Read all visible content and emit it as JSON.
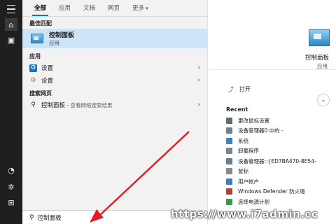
{
  "tabs": [
    {
      "label": "全部",
      "active": true
    },
    {
      "label": "应用"
    },
    {
      "label": "文档"
    },
    {
      "label": "网页"
    },
    {
      "label": "更多",
      "caret": "▾"
    }
  ],
  "best_match": {
    "header": "最佳匹配",
    "title": "控制面板",
    "subtitle": "应用"
  },
  "apps": {
    "header": "应用",
    "items": [
      {
        "label": "设置",
        "icon": "gear-blue-icon"
      },
      {
        "label": "设置",
        "icon": "gear-orange-icon"
      }
    ]
  },
  "web": {
    "header": "搜索网页",
    "items": [
      {
        "label": "控制面板",
        "sub": " - 查看网络搜索结果"
      }
    ]
  },
  "search": {
    "value": "控制面板"
  },
  "preview": {
    "title": "控制面板",
    "subtitle": "应用",
    "open_label": "打开",
    "recent_header": "Recent",
    "recent": [
      {
        "label": "更改鼠标设置",
        "color": "#5b6d7a"
      },
      {
        "label": "设备管理器0 中的 -",
        "color": "#6f7f8e"
      },
      {
        "label": "系统",
        "color": "#2d89c8"
      },
      {
        "label": "卸载程序",
        "color": "#7a8590"
      },
      {
        "label": "设备管理器::{ED7BA470-8E54-",
        "color": "#6b7c8c"
      },
      {
        "label": "鼠标",
        "color": "#888888"
      },
      {
        "label": "用户帐户",
        "color": "#3a7bc8"
      },
      {
        "label": "Windows Defender 防火墙",
        "color": "#c0392b"
      },
      {
        "label": "选择电源计划",
        "color": "#2f9e44"
      }
    ]
  },
  "watermark": "https://www.i7admin.cc",
  "colors": {
    "accent": "#0078d7",
    "highlight": "#cce4f7",
    "arrow": "#e02020"
  }
}
